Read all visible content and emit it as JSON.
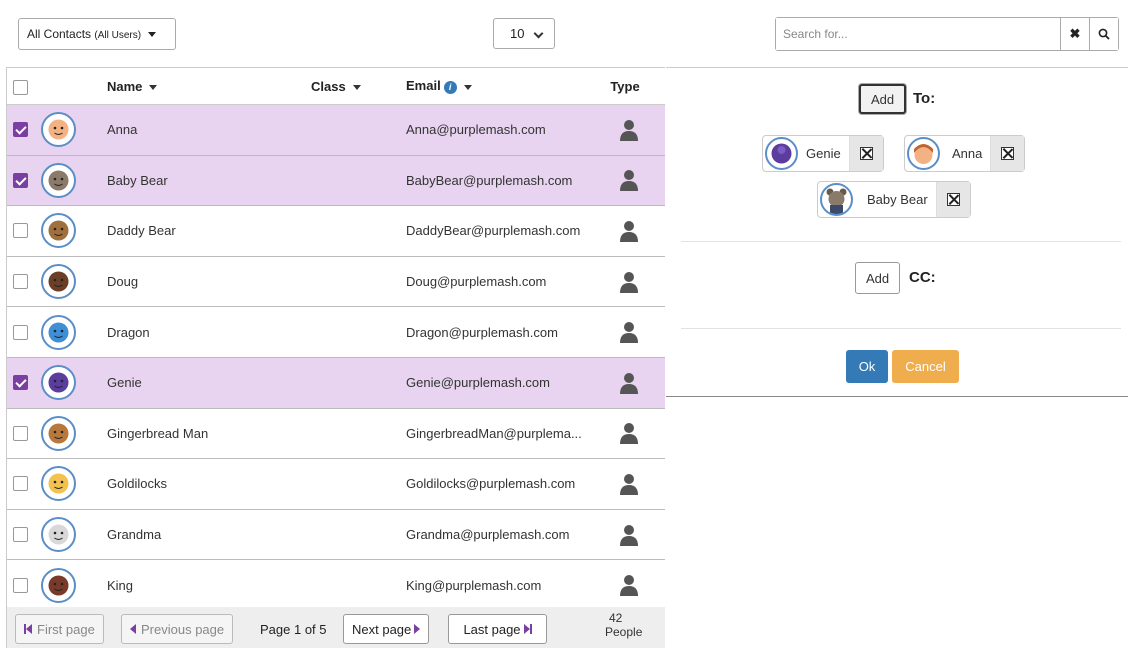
{
  "toolbar": {
    "filter_label": "All Contacts",
    "filter_sublabel": "(All Users)",
    "page_size": "10",
    "search_placeholder": "Search for...",
    "clear_glyph": "✖",
    "search_glyph": "⚲"
  },
  "table": {
    "headers": {
      "name": "Name",
      "class": "Class",
      "email": "Email",
      "type": "Type"
    },
    "rows": [
      {
        "name": "Anna",
        "class": "",
        "email": "Anna@purplemash.com",
        "selected": true,
        "avatar": "girl-avatar",
        "color": "#f4b183"
      },
      {
        "name": "Baby Bear",
        "class": "",
        "email": "BabyBear@purplemash.com",
        "selected": true,
        "avatar": "bear-avatar",
        "color": "#8a7a6a"
      },
      {
        "name": "Daddy Bear",
        "class": "",
        "email": "DaddyBear@purplemash.com",
        "selected": false,
        "avatar": "bear-avatar",
        "color": "#a0703c"
      },
      {
        "name": "Doug",
        "class": "",
        "email": "Doug@purplemash.com",
        "selected": false,
        "avatar": "boy-avatar",
        "color": "#6b3e26"
      },
      {
        "name": "Dragon",
        "class": "",
        "email": "Dragon@purplemash.com",
        "selected": false,
        "avatar": "dragon-avatar",
        "color": "#3f8fd6"
      },
      {
        "name": "Genie",
        "class": "",
        "email": "Genie@purplemash.com",
        "selected": true,
        "avatar": "genie-avatar",
        "color": "#5b3d9e"
      },
      {
        "name": "Gingerbread Man",
        "class": "",
        "email": "GingerbreadMan@purplema...",
        "selected": false,
        "avatar": "gingerbread-avatar",
        "color": "#b8783c"
      },
      {
        "name": "Goldilocks",
        "class": "",
        "email": "Goldilocks@purplemash.com",
        "selected": false,
        "avatar": "girl-avatar",
        "color": "#f2c14e"
      },
      {
        "name": "Grandma",
        "class": "",
        "email": "Grandma@purplemash.com",
        "selected": false,
        "avatar": "grandma-avatar",
        "color": "#d8d8d8"
      },
      {
        "name": "King",
        "class": "",
        "email": "King@purplemash.com",
        "selected": false,
        "avatar": "king-avatar",
        "color": "#7a3a2a"
      }
    ]
  },
  "pager": {
    "first": "First page",
    "previous": "Previous page",
    "status": "Page 1 of 5",
    "next": "Next page",
    "last": "Last page",
    "count_number": "42",
    "count_label": "People"
  },
  "recipients": {
    "add_label": "Add",
    "to_label": "To:",
    "cc_label": "CC:",
    "to_chips": [
      {
        "name": "Genie",
        "color": "#5b3d9e"
      },
      {
        "name": "Anna",
        "color": "#f4b183"
      },
      {
        "name": "Baby Bear",
        "color": "#8a7a6a"
      }
    ],
    "ok": "Ok",
    "cancel": "Cancel"
  },
  "colors": {
    "selected_row": "#e8d4f0",
    "accent_purple": "#7a3fa0",
    "ok_blue": "#337ab7",
    "cancel_orange": "#f0ad4e"
  }
}
